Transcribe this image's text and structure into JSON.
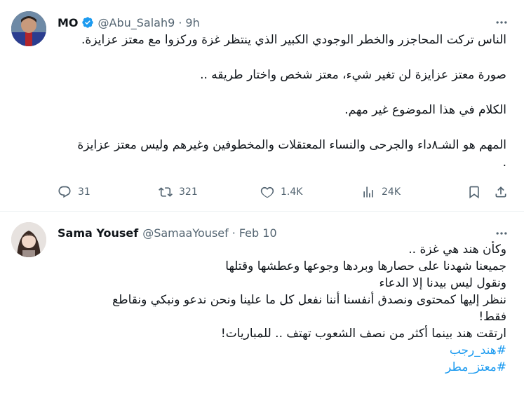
{
  "tweet1": {
    "author_name": "MO",
    "handle": "@Abu_Salah9",
    "separator": "·",
    "time": "9h",
    "paragraphs": [
      [
        "الناس تركت المحاجزر والخطر الوجودي الكبير الذي ينتظر غزة وركزوا مع معتز عزايزة."
      ],
      [
        "صورة معتز عزايزة لن تغير شيء، معتز شخص واختار طريقه .."
      ],
      [
        "الكلام في هذا الموضوع غير مهم."
      ],
      [
        "المهم هو الشـ٨داء والجرحى والنساء المعتقلات والمخطوفين وغيرهم وليس معتز عزايزة",
        "."
      ]
    ],
    "actions": {
      "reply_count": "31",
      "retweet_count": "321",
      "like_count": "1.4K",
      "views_count": "24K"
    }
  },
  "tweet2": {
    "author_name": "Sama Yousef",
    "handle": "@SamaaYousef",
    "separator": "·",
    "time": "Feb 10",
    "lines": [
      "وكأن هند هي غزة ..",
      "جميعنا شهدنا على حصارها وبردها وجوعها وعطشها وقتلها",
      "ونقول ليس بيدنا إلا الدعاء",
      "ننظر إليها كمحتوى ونصدق أنفسنا أننا نفعل كل ما علينا ونحن ندعو ونبكي ونقاطع",
      "فقط!",
      "ارتقت هند بينما أكثر من نصف الشعوب تهتف .. للمباريات!"
    ],
    "hashtags": [
      "#هند_رجب",
      "#معتز_مطر"
    ]
  },
  "colors": {
    "accent": "#1d9bf0",
    "secondary_text": "#536471",
    "primary_text": "#0f1419",
    "divider": "#eff3f4"
  },
  "icons": [
    "verified-badge-icon",
    "more-icon",
    "reply-icon",
    "retweet-icon",
    "like-icon",
    "views-icon",
    "bookmark-icon",
    "share-icon"
  ]
}
